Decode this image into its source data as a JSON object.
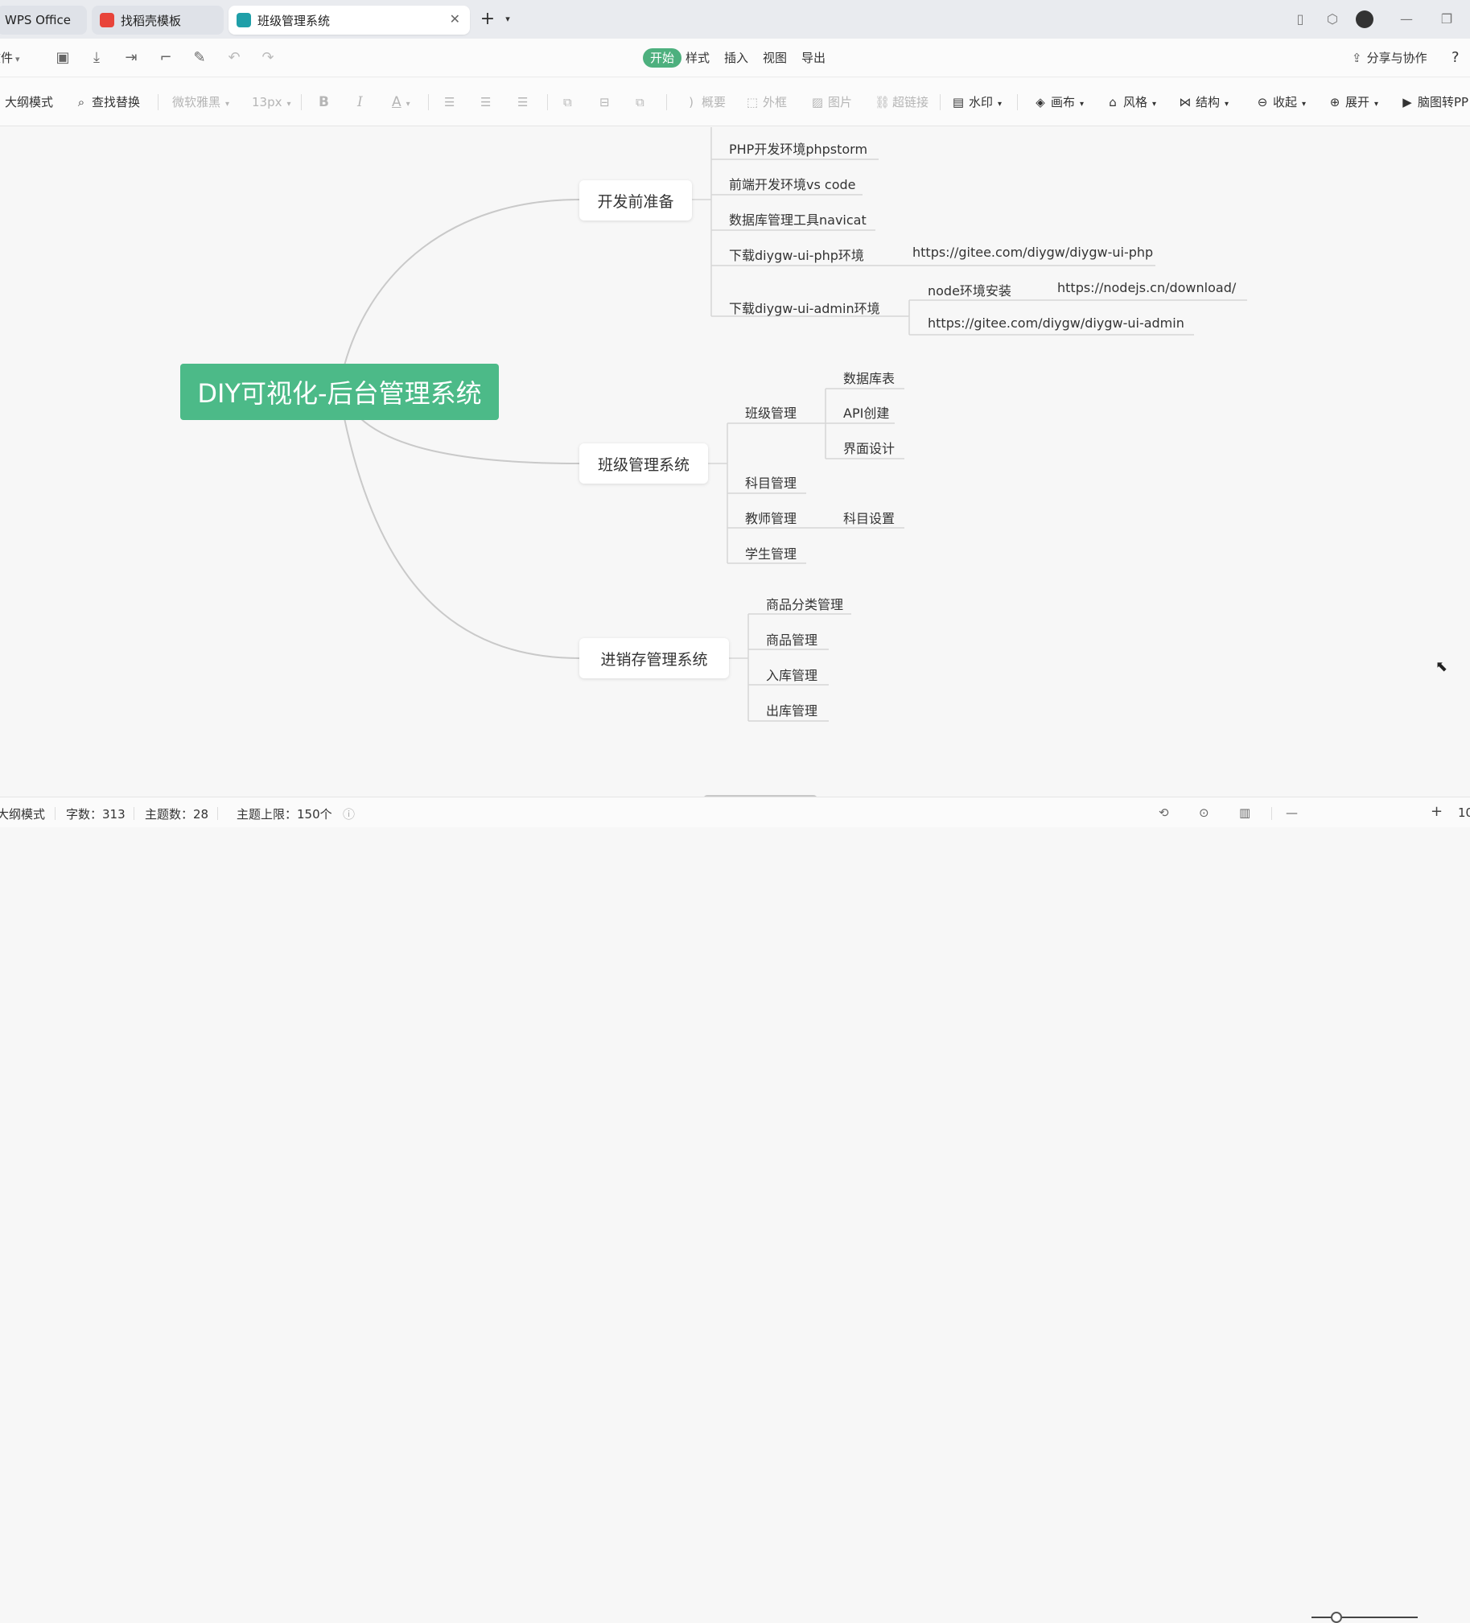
{
  "tabs": [
    {
      "label": "WPS Office"
    },
    {
      "label": "找稻壳模板"
    },
    {
      "label": "班级管理系统"
    }
  ],
  "menubar": {
    "file_label": "文件",
    "tabs": [
      "开始",
      "样式",
      "插入",
      "视图",
      "导出"
    ],
    "share_label": "分享与协作",
    "help": "?"
  },
  "toolbar": {
    "outline_mode": "大纲模式",
    "find_replace": "查找替换",
    "font_family": "微软雅黑",
    "font_size": "13px",
    "bold": "B",
    "italic": "I",
    "font_color": "A",
    "summary": "概要",
    "frame": "外框",
    "image": "图片",
    "hyperlink": "超链接",
    "watermark": "水印",
    "canvas": "画布",
    "style": "风格",
    "structure": "结构",
    "collapse": "收起",
    "expand": "展开",
    "to_ppt": "脑图转PP"
  },
  "mindmap": {
    "root": "DIY可视化-后台管理系统",
    "branches": [
      {
        "label": "开发前准备",
        "children": [
          {
            "label": "PHP开发环境phpstorm"
          },
          {
            "label": "前端开发环境vs code"
          },
          {
            "label": "数据库管理工具navicat"
          },
          {
            "label": "下载diygw-ui-php环境",
            "children": [
              {
                "label": "https://gitee.com/diygw/diygw-ui-php"
              }
            ]
          },
          {
            "label": "下载diygw-ui-admin环境",
            "children": [
              {
                "label": "node环境安装",
                "children": [
                  {
                    "label": "https://nodejs.cn/download/"
                  }
                ]
              },
              {
                "label": "https://gitee.com/diygw/diygw-ui-admin"
              }
            ]
          }
        ]
      },
      {
        "label": "班级管理系统",
        "children": [
          {
            "label": "班级管理",
            "children": [
              {
                "label": "数据库表"
              },
              {
                "label": "API创建"
              },
              {
                "label": "界面设计"
              }
            ]
          },
          {
            "label": "科目管理"
          },
          {
            "label": "教师管理",
            "children": [
              {
                "label": "科目设置"
              }
            ]
          },
          {
            "label": "学生管理"
          }
        ]
      },
      {
        "label": "进销存管理系统",
        "children": [
          {
            "label": "商品分类管理"
          },
          {
            "label": "商品管理"
          },
          {
            "label": "入库管理"
          },
          {
            "label": "出库管理"
          }
        ]
      }
    ]
  },
  "statusbar": {
    "mode": "大纲模式",
    "word_count": "字数：313",
    "topic_count": "主题数：28",
    "topic_limit": "主题上限：150个",
    "zoom_partial": "10"
  },
  "colors": {
    "accent": "#4cba88",
    "connector": "#c9c9c9",
    "tab_bar": "#e9ebef"
  }
}
